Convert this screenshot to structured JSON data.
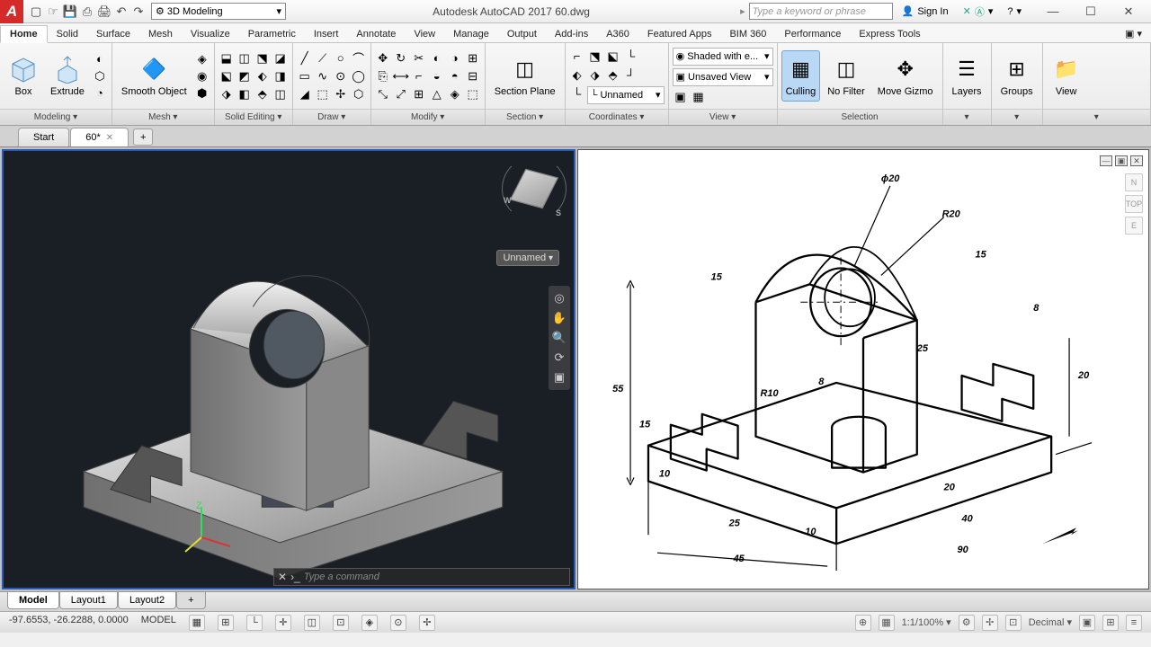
{
  "app": {
    "title": "Autodesk AutoCAD 2017   60.dwg"
  },
  "workspace_selector": "3D Modeling",
  "search": {
    "placeholder": "Type a keyword or phrase"
  },
  "signin": "Sign In",
  "ribbon_tabs": [
    "Home",
    "Solid",
    "Surface",
    "Mesh",
    "Visualize",
    "Parametric",
    "Insert",
    "Annotate",
    "View",
    "Manage",
    "Output",
    "Add-ins",
    "A360",
    "Featured Apps",
    "BIM 360",
    "Performance",
    "Express Tools"
  ],
  "panels": {
    "modeling": {
      "box": "Box",
      "extrude": "Extrude",
      "title": "Modeling ▾"
    },
    "mesh": {
      "smooth": "Smooth Object",
      "title": "Mesh ▾"
    },
    "solid_edit": {
      "title": "Solid Editing ▾"
    },
    "draw": {
      "title": "Draw ▾"
    },
    "modify": {
      "title": "Modify ▾"
    },
    "section": {
      "label": "Section Plane",
      "title": "Section ▾"
    },
    "coord": {
      "title": "Coordinates ▾",
      "unnamed": "Unnamed"
    },
    "view": {
      "title": "View ▾",
      "shaded": "Shaded with e...",
      "unsaved": "Unsaved View"
    },
    "selection": {
      "culling": "Culling",
      "nofilter": "No Filter",
      "gizmo": "Move Gizmo",
      "title": "Selection"
    },
    "layers": {
      "title": "Layers",
      "label": "Layers"
    },
    "groups": {
      "title": "Groups",
      "label": "Groups"
    },
    "viewp": {
      "title": "View",
      "label": "View"
    }
  },
  "file_tabs": [
    {
      "label": "Start"
    },
    {
      "label": "60*",
      "active": true
    }
  ],
  "viewport": {
    "ucs_unnamed": "Unnamed",
    "compass": {
      "w": "W",
      "s": "S"
    }
  },
  "cmdline": {
    "placeholder": "Type a command"
  },
  "bottom_tabs": [
    "Model",
    "Layout1",
    "Layout2"
  ],
  "status": {
    "coords": "-97.6553, -26.2288, 0.0000",
    "model": "MODEL",
    "scale": "1:1/100% ▾",
    "decimal": "Decimal ▾"
  },
  "drawing_dims": [
    "ϕ20",
    "R20",
    "15",
    "15",
    "55",
    "15",
    "10",
    "R10",
    "8",
    "25",
    "8",
    "20",
    "25",
    "40",
    "45",
    "10",
    "90"
  ],
  "vp2_nav": [
    "N",
    "TOP",
    "E"
  ]
}
